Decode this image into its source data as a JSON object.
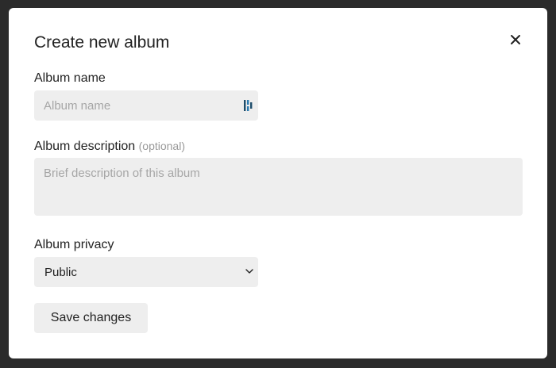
{
  "modal": {
    "title": "Create new album",
    "close_icon": "close-icon"
  },
  "album_name": {
    "label": "Album name",
    "value": "",
    "placeholder": "Album name",
    "password_manager_icon": "password-manager-icon"
  },
  "album_description": {
    "label": "Album description",
    "optional_hint": "(optional)",
    "value": "",
    "placeholder": "Brief description of this album"
  },
  "album_privacy": {
    "label": "Album privacy",
    "selected": "Public",
    "dropdown_icon": "chevron-down-icon"
  },
  "actions": {
    "save_label": "Save changes"
  }
}
